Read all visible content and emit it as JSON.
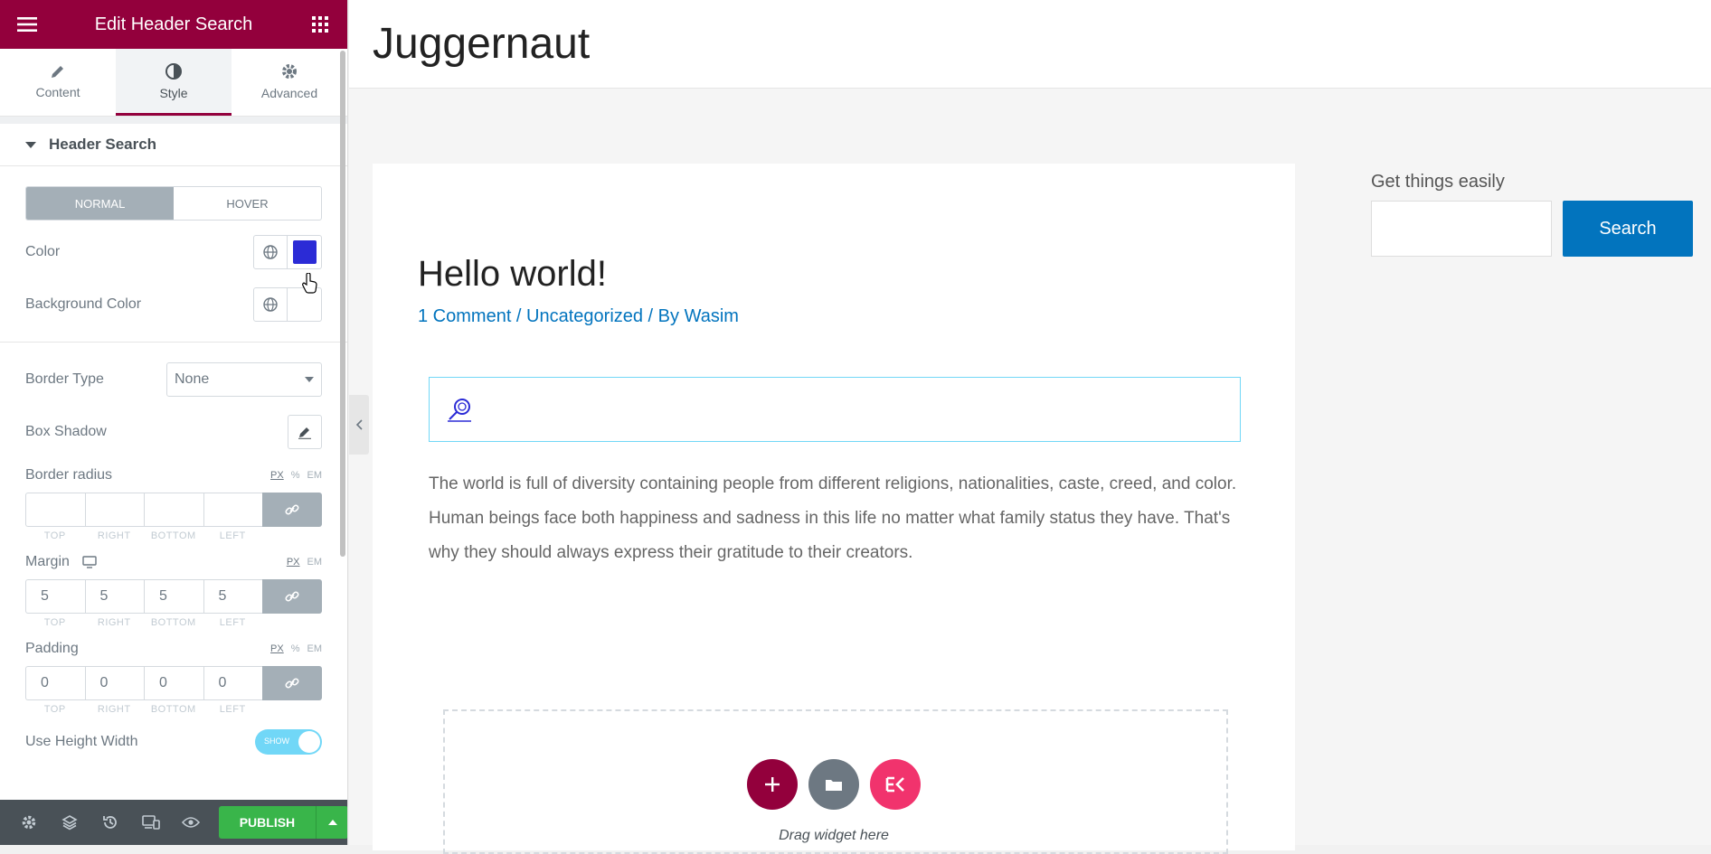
{
  "panel": {
    "title": "Edit Header Search",
    "tabs": [
      {
        "label": "Content"
      },
      {
        "label": "Style"
      },
      {
        "label": "Advanced"
      }
    ],
    "section": "Header Search",
    "state_tabs": {
      "normal": "NORMAL",
      "hover": "HOVER"
    },
    "color_label": "Color",
    "color_value": "#2b2bd6",
    "bg_color_label": "Background Color",
    "border_type_label": "Border Type",
    "border_type_value": "None",
    "box_shadow_label": "Box Shadow",
    "border_radius": {
      "label": "Border radius",
      "units": [
        "PX",
        "%",
        "EM"
      ],
      "values": [
        "",
        "",
        "",
        ""
      ]
    },
    "margin": {
      "label": "Margin",
      "units": [
        "PX",
        "EM"
      ],
      "values": [
        "5",
        "5",
        "5",
        "5"
      ]
    },
    "padding": {
      "label": "Padding",
      "units": [
        "PX",
        "%",
        "EM"
      ],
      "values": [
        "0",
        "0",
        "0",
        "0"
      ]
    },
    "dim_labels": [
      "TOP",
      "RIGHT",
      "BOTTOM",
      "LEFT"
    ],
    "use_height_width": {
      "label": "Use Height Width",
      "toggle": "SHOW"
    }
  },
  "footer": {
    "publish": "PUBLISH"
  },
  "preview": {
    "site_title": "Juggernaut",
    "post_title": "Hello world!",
    "meta": "1 Comment / Uncategorized / By Wasim",
    "body": "The world is full of diversity containing people from different religions, nationalities, caste, creed, and color. Human beings face both happiness and sadness in this life no matter what family status they have. That's why they should always express their gratitude to their creators.",
    "drop_text": "Drag widget here",
    "sidebar_title": "Get things easily",
    "sidebar_button": "Search"
  },
  "colors": {
    "brand": "#93003c",
    "link": "#0274be",
    "publish": "#39b54a",
    "widget_border": "#71d7f7",
    "ek": "#f1336d"
  }
}
